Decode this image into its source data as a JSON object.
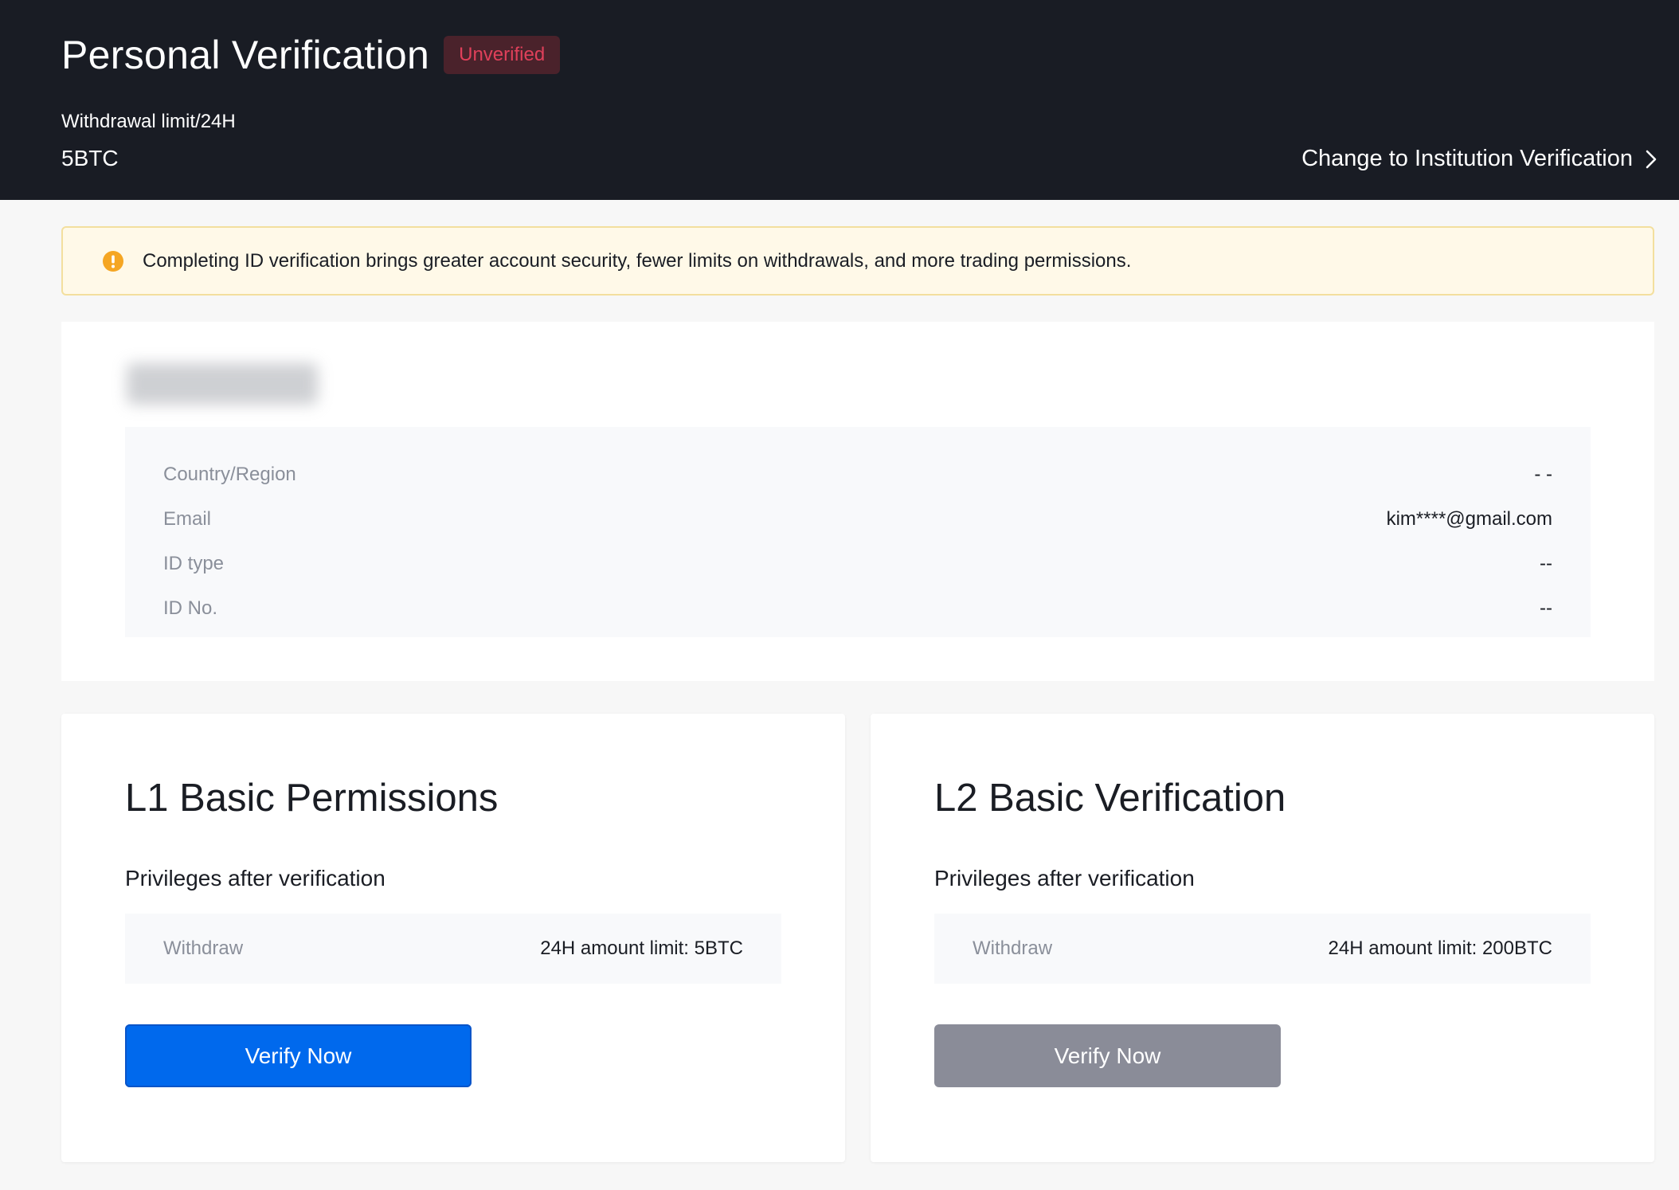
{
  "header": {
    "title": "Personal Verification",
    "status_badge": "Unverified",
    "limit_label": "Withdrawal limit/24H",
    "limit_value": "5BTC",
    "change_link": "Change to Institution Verification"
  },
  "notice": {
    "icon": "warning-icon",
    "text": "Completing ID verification brings greater account security, fewer limits on withdrawals, and more trading permissions."
  },
  "profile": {
    "rows": [
      {
        "label": "Country/Region",
        "value": "- -"
      },
      {
        "label": "Email",
        "value": "kim****@gmail.com"
      },
      {
        "label": "ID type",
        "value": "--"
      },
      {
        "label": "ID No.",
        "value": "--"
      }
    ]
  },
  "levels": [
    {
      "title": "L1 Basic Permissions",
      "subtitle": "Privileges after verification",
      "privilege_label": "Withdraw",
      "privilege_value": "24H amount limit: 5BTC",
      "button_label": "Verify Now",
      "button_state": "enabled"
    },
    {
      "title": "L2 Basic Verification",
      "subtitle": "Privileges after verification",
      "privilege_label": "Withdraw",
      "privilege_value": "24H amount limit: 200BTC",
      "button_label": "Verify Now",
      "button_state": "disabled"
    }
  ],
  "colors": {
    "header_bg": "#191c24",
    "badge_bg": "#4a222b",
    "badge_text": "#e0405a",
    "notice_bg": "#fff9e8",
    "notice_border": "#f3df9e",
    "notice_icon": "#f5a623",
    "primary": "#0069ed",
    "disabled": "#8a8c98"
  }
}
